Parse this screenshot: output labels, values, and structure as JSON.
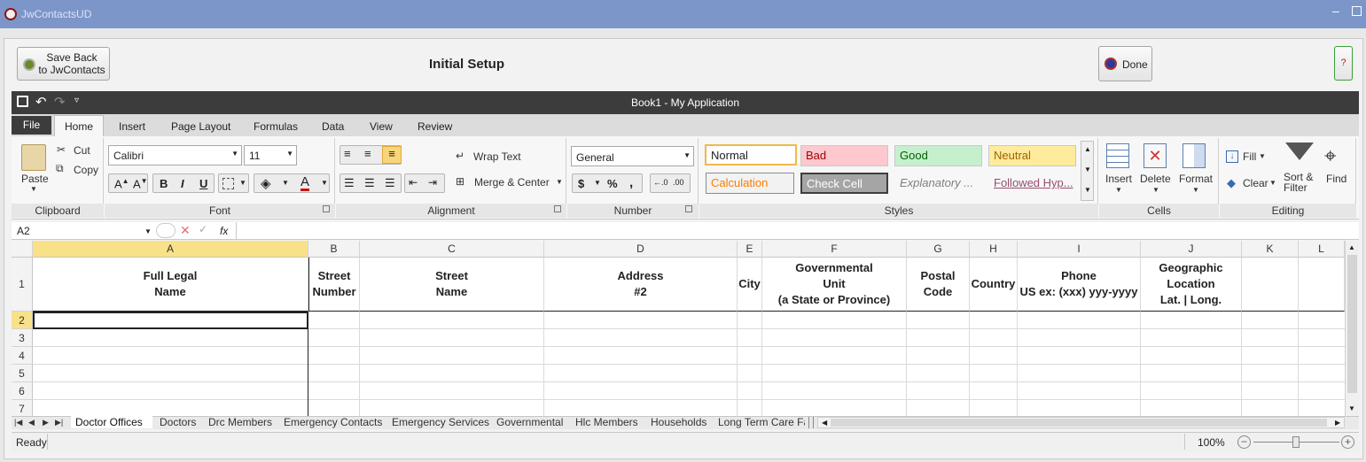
{
  "window": {
    "title": "JwContactsUD",
    "minimize_icon": "minimize-icon",
    "maximize_icon": "maximize-icon"
  },
  "header": {
    "save_label": "Save Back\nto JwContacts",
    "page_title": "Initial Setup",
    "done_label": "Done",
    "help_label": "?"
  },
  "sheet": {
    "title": "Book1 - My Application"
  },
  "ribbon": {
    "tabs": [
      "File",
      "Home",
      "Insert",
      "Page Layout",
      "Formulas",
      "Data",
      "View",
      "Review"
    ],
    "clipboard": {
      "paste": "Paste",
      "cut": "Cut",
      "copy": "Copy",
      "label": "Clipboard"
    },
    "font": {
      "name": "Calibri",
      "size": "11",
      "label": "Font",
      "bold": "B",
      "italic": "I",
      "underline": "U",
      "color_letter": "A"
    },
    "alignment": {
      "wrap": "Wrap Text",
      "merge": "Merge & Center",
      "label": "Alignment"
    },
    "number": {
      "format": "General",
      "currency": "$",
      "percent": "%",
      "comma": ",",
      "label": "Number"
    },
    "styles": {
      "label": "Styles",
      "items": [
        "Normal",
        "Bad",
        "Good",
        "Neutral",
        "Calculation",
        "Check Cell",
        "Explanatory ...",
        "Followed Hyp..."
      ]
    },
    "cells": {
      "insert": "Insert",
      "delete": "Delete",
      "format": "Format",
      "label": "Cells"
    },
    "editing": {
      "fill": "Fill",
      "clear": "Clear",
      "sort": "Sort &\nFilter",
      "find": "Find",
      "label": "Editing"
    }
  },
  "formula_bar": {
    "name_box": "A2",
    "fx": "fx",
    "value": ""
  },
  "grid": {
    "columns": [
      "A",
      "B",
      "C",
      "D",
      "E",
      "F",
      "G",
      "H",
      "I",
      "J",
      "K",
      "L"
    ],
    "rows": [
      "1",
      "2",
      "3",
      "4",
      "5",
      "6",
      "7"
    ],
    "headers": [
      "Full Legal\nName",
      "Street\nNumber",
      "Street\nName",
      "Address\n#2",
      "City",
      "Governmental\nUnit\n(a State or Province)",
      "Postal\nCode",
      "Country",
      "Phone\nUS ex: (xxx) yyy-yyyy",
      "Geographic\nLocation\nLat. | Long.",
      "",
      ""
    ]
  },
  "sheet_tabs": [
    "Doctor Offices",
    "Doctors",
    "Drc Members",
    "Emergency Contacts",
    "Emergency Services",
    "Governmental",
    "Hlc Members",
    "Households",
    "Long Term Care Fa"
  ],
  "status": {
    "text": "Ready",
    "zoom": "100%",
    "zoom_level": 1.0
  },
  "colors": {
    "title_bar": "#7d96c9",
    "dark_bar": "#3c3c3c",
    "selected_header": "#f9e18a",
    "normal_style_border": "#f0b94a",
    "bad_bg": "#ffc7ce",
    "bad_fg": "#9c0006",
    "good_bg": "#c6efce",
    "good_fg": "#006100",
    "neutral_bg": "#ffeb9c",
    "neutral_fg": "#9c6500",
    "calc_fg": "#fa7d00",
    "check_bg": "#a5a5a5",
    "hyperlink": "#954f72"
  }
}
